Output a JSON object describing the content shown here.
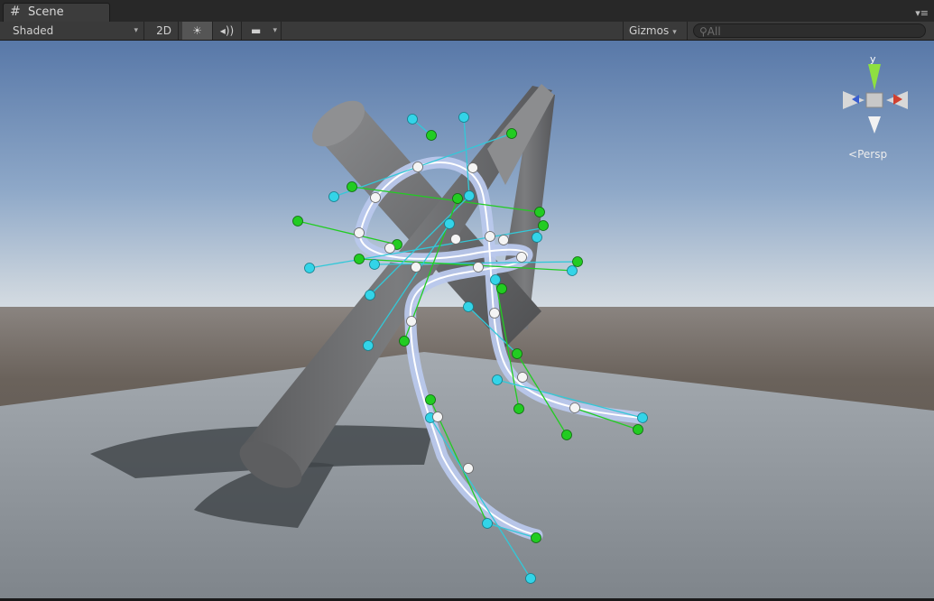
{
  "window": {
    "tab_icon": "grid-hash-icon",
    "tab_icon_glyph": "#",
    "tab_title": "Scene",
    "tab_menu_glyph": "▾≡"
  },
  "toolbar": {
    "shading_mode": "Shaded",
    "mode_2d": "2D",
    "lighting_icon": "sun-icon",
    "lighting_glyph": "☀",
    "audio_icon": "speaker-icon",
    "audio_glyph": "◂))",
    "effects_icon": "image-icon",
    "effects_glyph": "▬",
    "gizmos_label": "Gizmos",
    "search_placeholder": "All",
    "search_icon": "search-icon"
  },
  "scene": {
    "projection_label": "Persp",
    "axis_y_label": "y",
    "colors": {
      "sky_top": "#5878a8",
      "horizon": "#d6dde3",
      "ground": "#5f5750",
      "plane": "#8d9298",
      "cylinder": "#737476",
      "tube": "#b9c8ec",
      "tangent_green": "#22cc22",
      "tangent_cyan": "#33c8d8",
      "knot_white": "#f4f4f4"
    }
  }
}
